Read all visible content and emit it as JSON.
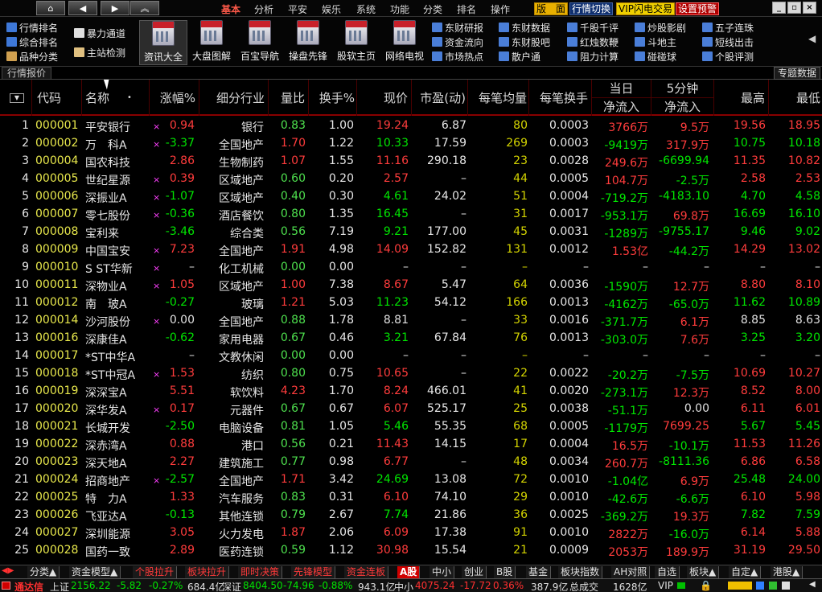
{
  "menubar": {
    "items": [
      "基本",
      "分析",
      "平安",
      "娱乐",
      "系统",
      "功能",
      "分类",
      "排名",
      "操作"
    ],
    "active": "基本",
    "right_buttons": [
      "版　面",
      "行情切换",
      "VIP闪电交易",
      "设置预警"
    ]
  },
  "toolbar": {
    "left_col1": [
      "行情排名",
      "综合排名",
      "品种分类"
    ],
    "left_col2": [
      "暴力通道",
      "主站检测"
    ],
    "big_buttons": [
      "资讯大全",
      "大盘图解",
      "百宝导航",
      "操盘先锋",
      "股软主页",
      "网络电视"
    ],
    "small_grid": [
      [
        "东财研报",
        "资金流向",
        "市场热点"
      ],
      [
        "东财数据",
        "东财股吧",
        "散户通"
      ],
      [
        "千股千评",
        "红烛数鞭",
        "阻力计算"
      ],
      [
        "炒股影剧",
        "斗地主",
        "碰碰球"
      ],
      [
        "五子连珠",
        "短线出击",
        "个股评测"
      ]
    ]
  },
  "subbar": {
    "tab": "行情报价",
    "right": "专题数据"
  },
  "table": {
    "headers": [
      "代码",
      "名称",
      "涨幅%",
      "细分行业",
      "量比",
      "换手%",
      "现价",
      "市盈(动)",
      "每笔均量",
      "每笔换手",
      "当日",
      "净流入",
      "5分钟",
      "净流入",
      "最高",
      "最低"
    ],
    "rows": [
      [
        "1",
        "000001",
        "平安银行",
        "×",
        "0.94",
        "银行",
        "0.83",
        "1.00",
        "19.24",
        "6.87",
        "80",
        "0.0003",
        "3766万",
        "9.5万",
        "19.56",
        "18.95"
      ],
      [
        "2",
        "000002",
        "万　科A",
        "×",
        "-3.37",
        "全国地产",
        "1.70",
        "1.22",
        "10.33",
        "17.59",
        "269",
        "0.0003",
        "-9419万",
        "317.9万",
        "10.75",
        "10.18"
      ],
      [
        "3",
        "000004",
        "国农科技",
        "",
        "2.86",
        "生物制药",
        "1.07",
        "1.55",
        "11.16",
        "290.18",
        "23",
        "0.0028",
        "249.6万",
        "-6699.94",
        "11.35",
        "10.82"
      ],
      [
        "4",
        "000005",
        "世纪星源",
        "×",
        "0.39",
        "区域地产",
        "0.60",
        "0.20",
        "2.57",
        "–",
        "44",
        "0.0005",
        "104.7万",
        "-2.5万",
        "2.58",
        "2.53"
      ],
      [
        "5",
        "000006",
        "深振业A",
        "×",
        "-1.07",
        "区域地产",
        "0.40",
        "0.30",
        "4.61",
        "24.02",
        "51",
        "0.0004",
        "-719.2万",
        "-4183.10",
        "4.70",
        "4.58"
      ],
      [
        "6",
        "000007",
        "零七股份",
        "×",
        "-0.36",
        "酒店餐饮",
        "0.80",
        "1.35",
        "16.45",
        "–",
        "31",
        "0.0017",
        "-953.1万",
        "69.8万",
        "16.69",
        "16.10"
      ],
      [
        "7",
        "000008",
        "宝利来",
        "",
        "-3.46",
        "综合类",
        "0.56",
        "7.19",
        "9.21",
        "177.00",
        "45",
        "0.0031",
        "-1289万",
        "-9755.17",
        "9.46",
        "9.02"
      ],
      [
        "8",
        "000009",
        "中国宝安",
        "×",
        "7.23",
        "全国地产",
        "1.91",
        "4.98",
        "14.09",
        "152.82",
        "131",
        "0.0012",
        "1.53亿",
        "-44.2万",
        "14.29",
        "13.02"
      ],
      [
        "9",
        "000010",
        "S ST华新",
        "×",
        "–",
        "化工机械",
        "0.00",
        "0.00",
        "–",
        "–",
        "–",
        "–",
        "–",
        "–",
        "–",
        "–"
      ],
      [
        "10",
        "000011",
        "深物业A",
        "×",
        "1.05",
        "区域地产",
        "1.00",
        "7.38",
        "8.67",
        "5.47",
        "64",
        "0.0036",
        "-1590万",
        "12.7万",
        "8.80",
        "8.10"
      ],
      [
        "11",
        "000012",
        "南　玻A",
        "",
        "-0.27",
        "玻璃",
        "1.21",
        "5.03",
        "11.23",
        "54.12",
        "166",
        "0.0013",
        "-4162万",
        "-65.0万",
        "11.62",
        "10.89"
      ],
      [
        "12",
        "000014",
        "沙河股份",
        "×",
        "0.00",
        "全国地产",
        "0.88",
        "1.78",
        "8.81",
        "–",
        "33",
        "0.0016",
        "-371.7万",
        "6.1万",
        "8.85",
        "8.63"
      ],
      [
        "13",
        "000016",
        "深康佳A",
        "",
        "-0.62",
        "家用电器",
        "0.67",
        "0.46",
        "3.21",
        "67.84",
        "76",
        "0.0013",
        "-303.0万",
        "7.6万",
        "3.25",
        "3.20"
      ],
      [
        "14",
        "000017",
        "*ST中华A",
        "",
        "–",
        "文教休闲",
        "0.00",
        "0.00",
        "–",
        "–",
        "–",
        "–",
        "–",
        "–",
        "–",
        "–"
      ],
      [
        "15",
        "000018",
        "*ST中冠A",
        "×",
        "1.53",
        "纺织",
        "0.80",
        "0.75",
        "10.65",
        "–",
        "22",
        "0.0022",
        "-20.2万",
        "-7.5万",
        "10.69",
        "10.27"
      ],
      [
        "16",
        "000019",
        "深深宝A",
        "",
        "5.51",
        "软饮料",
        "4.23",
        "1.70",
        "8.24",
        "466.01",
        "41",
        "0.0020",
        "-273.1万",
        "12.3万",
        "8.52",
        "8.00"
      ],
      [
        "17",
        "000020",
        "深华发A",
        "×",
        "0.17",
        "元器件",
        "0.67",
        "0.67",
        "6.07",
        "525.17",
        "25",
        "0.0038",
        "-51.1万",
        "0.00",
        "6.11",
        "6.01"
      ],
      [
        "18",
        "000021",
        "长城开发",
        "",
        "-2.50",
        "电脑设备",
        "0.81",
        "1.05",
        "5.46",
        "55.35",
        "68",
        "0.0005",
        "-1179万",
        "7699.25",
        "5.67",
        "5.45"
      ],
      [
        "19",
        "000022",
        "深赤湾A",
        "",
        "0.88",
        "港口",
        "0.56",
        "0.21",
        "11.43",
        "14.15",
        "17",
        "0.0004",
        "16.5万",
        "-10.1万",
        "11.53",
        "11.26"
      ],
      [
        "20",
        "000023",
        "深天地A",
        "",
        "2.27",
        "建筑施工",
        "0.77",
        "0.98",
        "6.77",
        "–",
        "48",
        "0.0034",
        "260.7万",
        "-8111.36",
        "6.86",
        "6.58"
      ],
      [
        "21",
        "000024",
        "招商地产",
        "×",
        "-2.57",
        "全国地产",
        "1.71",
        "3.42",
        "24.69",
        "13.08",
        "72",
        "0.0010",
        "-1.04亿",
        "6.9万",
        "25.48",
        "24.00"
      ],
      [
        "22",
        "000025",
        "特　力A",
        "",
        "1.33",
        "汽车服务",
        "0.83",
        "0.31",
        "6.10",
        "74.10",
        "29",
        "0.0010",
        "-42.6万",
        "-6.6万",
        "6.10",
        "5.98"
      ],
      [
        "23",
        "000026",
        "飞亚达A",
        "",
        "-0.13",
        "其他连锁",
        "0.79",
        "2.67",
        "7.74",
        "21.86",
        "36",
        "0.0025",
        "-369.2万",
        "19.3万",
        "7.82",
        "7.59"
      ],
      [
        "24",
        "000027",
        "深圳能源",
        "",
        "3.05",
        "火力发电",
        "1.87",
        "2.06",
        "6.09",
        "17.38",
        "91",
        "0.0010",
        "2822万",
        "-16.0万",
        "6.14",
        "5.88"
      ],
      [
        "25",
        "000028",
        "国药一致",
        "",
        "2.89",
        "医药连锁",
        "0.59",
        "1.12",
        "30.98",
        "15.54",
        "21",
        "0.0009",
        "2053万",
        "189.9万",
        "31.19",
        "29.50"
      ]
    ]
  },
  "bottom_tabs": [
    "分类▲",
    "资金模型▲",
    "个股拉升",
    "板块拉升",
    "即时决策",
    "先锋模型",
    "资金连板",
    "A股",
    "中小",
    "创业",
    "B股",
    "基金",
    "板块指数",
    "AH对照",
    "自选",
    "板块▲",
    "自定▲",
    "港股▲"
  ],
  "statusbar": {
    "brand": "通达信",
    "sh_label": "上证",
    "sh_val": "2156.22",
    "sh_chg": "-5.82",
    "sh_pct": "-0.27%",
    "sh_amt": "684.4亿",
    "sz_label": "深证",
    "sz_val": "8404.50",
    "sz_chg": "-74.96",
    "sz_pct": "-0.88%",
    "sz_amt": "943.1亿",
    "zx_label": "中小",
    "zx_val": "4075.24",
    "zx_chg": "-17.72",
    "zx_pct": "0.36%",
    "zx_amt": "387.9亿",
    "deal_label": "总成交",
    "deal_val": "1628亿",
    "vip": "VIP"
  },
  "colors": {
    "up": "#ff3c3c",
    "down": "#00e600",
    "code": "#e8e84c",
    "turnover": "#00e0e0"
  }
}
